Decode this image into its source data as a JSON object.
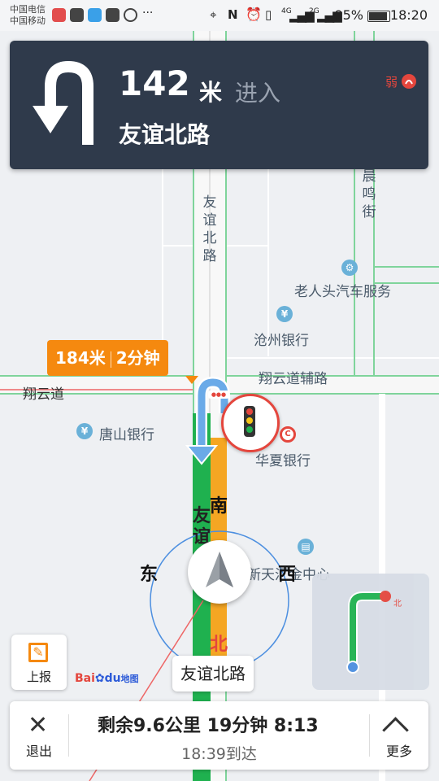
{
  "status_bar": {
    "carrier_1": "中国电信",
    "carrier_2": "中国移动",
    "battery": "95%",
    "time": "18:20",
    "net_1": "4G",
    "net_2": "2G"
  },
  "nav": {
    "distance": "142",
    "distance_unit": "米",
    "action": "进入",
    "road": "友谊北路",
    "signal_text": "弱",
    "turn_icon": "u-turn-left-icon"
  },
  "tooltip": {
    "distance": "184米",
    "time": "2分钟"
  },
  "map": {
    "road_vertical": "友谊北路",
    "road_right": "晨鸣街",
    "road_xiangyun": "翔云道",
    "road_xiangyun_aux": "翔云道辅路",
    "poi_car_service": "老人头汽车服务",
    "poi_cangzhou_bank": "沧州银行",
    "poi_tangshan_bank": "唐山银行",
    "poi_huaxia_bank": "华夏银行",
    "poi_huijin": "新天汇金中心",
    "route_road_vertical": "友谊北路"
  },
  "compass": {
    "east": "东",
    "west": "西",
    "south": "南",
    "north": "北"
  },
  "current_road": "友谊北路",
  "report_label": "上报",
  "brand": {
    "bai": "Bai",
    "du": "du",
    "map": "地图"
  },
  "bottom": {
    "exit_label": "退出",
    "remaining": "剩余9.6公里 19分钟 8:13",
    "arrival": "18:39到达",
    "more_label": "更多"
  },
  "colors": {
    "nav_card": "#2f3a4b",
    "route_green": "#1fb14f",
    "route_orange": "#f5a623",
    "tooltip_orange": "#f5890f",
    "accent_red": "#e4463d"
  }
}
